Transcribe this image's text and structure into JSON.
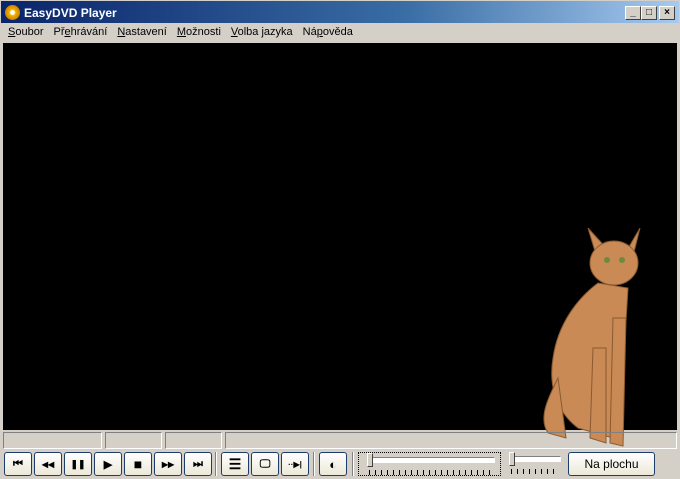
{
  "window": {
    "title": "EasyDVD Player",
    "minimize": "_",
    "maximize": "□",
    "close": "×"
  },
  "menu": [
    {
      "label": "Soubor",
      "accel": "S",
      "rest": "oubor"
    },
    {
      "label": "Přehrávání",
      "pre": "Př",
      "accel": "e",
      "rest": "hrávání"
    },
    {
      "label": "Nastavení",
      "accel": "N",
      "rest": "astavení"
    },
    {
      "label": "Možnosti",
      "accel": "M",
      "rest": "ožnosti"
    },
    {
      "label": "Volba jazyka",
      "accel": "V",
      "rest": "olba jazyka"
    },
    {
      "label": "Nápověda",
      "pre": "Ná",
      "accel": "p",
      "rest": "ověda"
    }
  ],
  "controls": {
    "prev": "⏮",
    "rewind": "◀◀",
    "pause": "❚❚",
    "play": "▶",
    "stop": "■",
    "forward": "▶▶",
    "next": "⏭",
    "playlist": "☰",
    "display": "🖵",
    "step": "··▶|",
    "brightness": "◐"
  },
  "seek_position": 0.0,
  "volume_position": 0.0,
  "desktop_button": "Na plochu"
}
